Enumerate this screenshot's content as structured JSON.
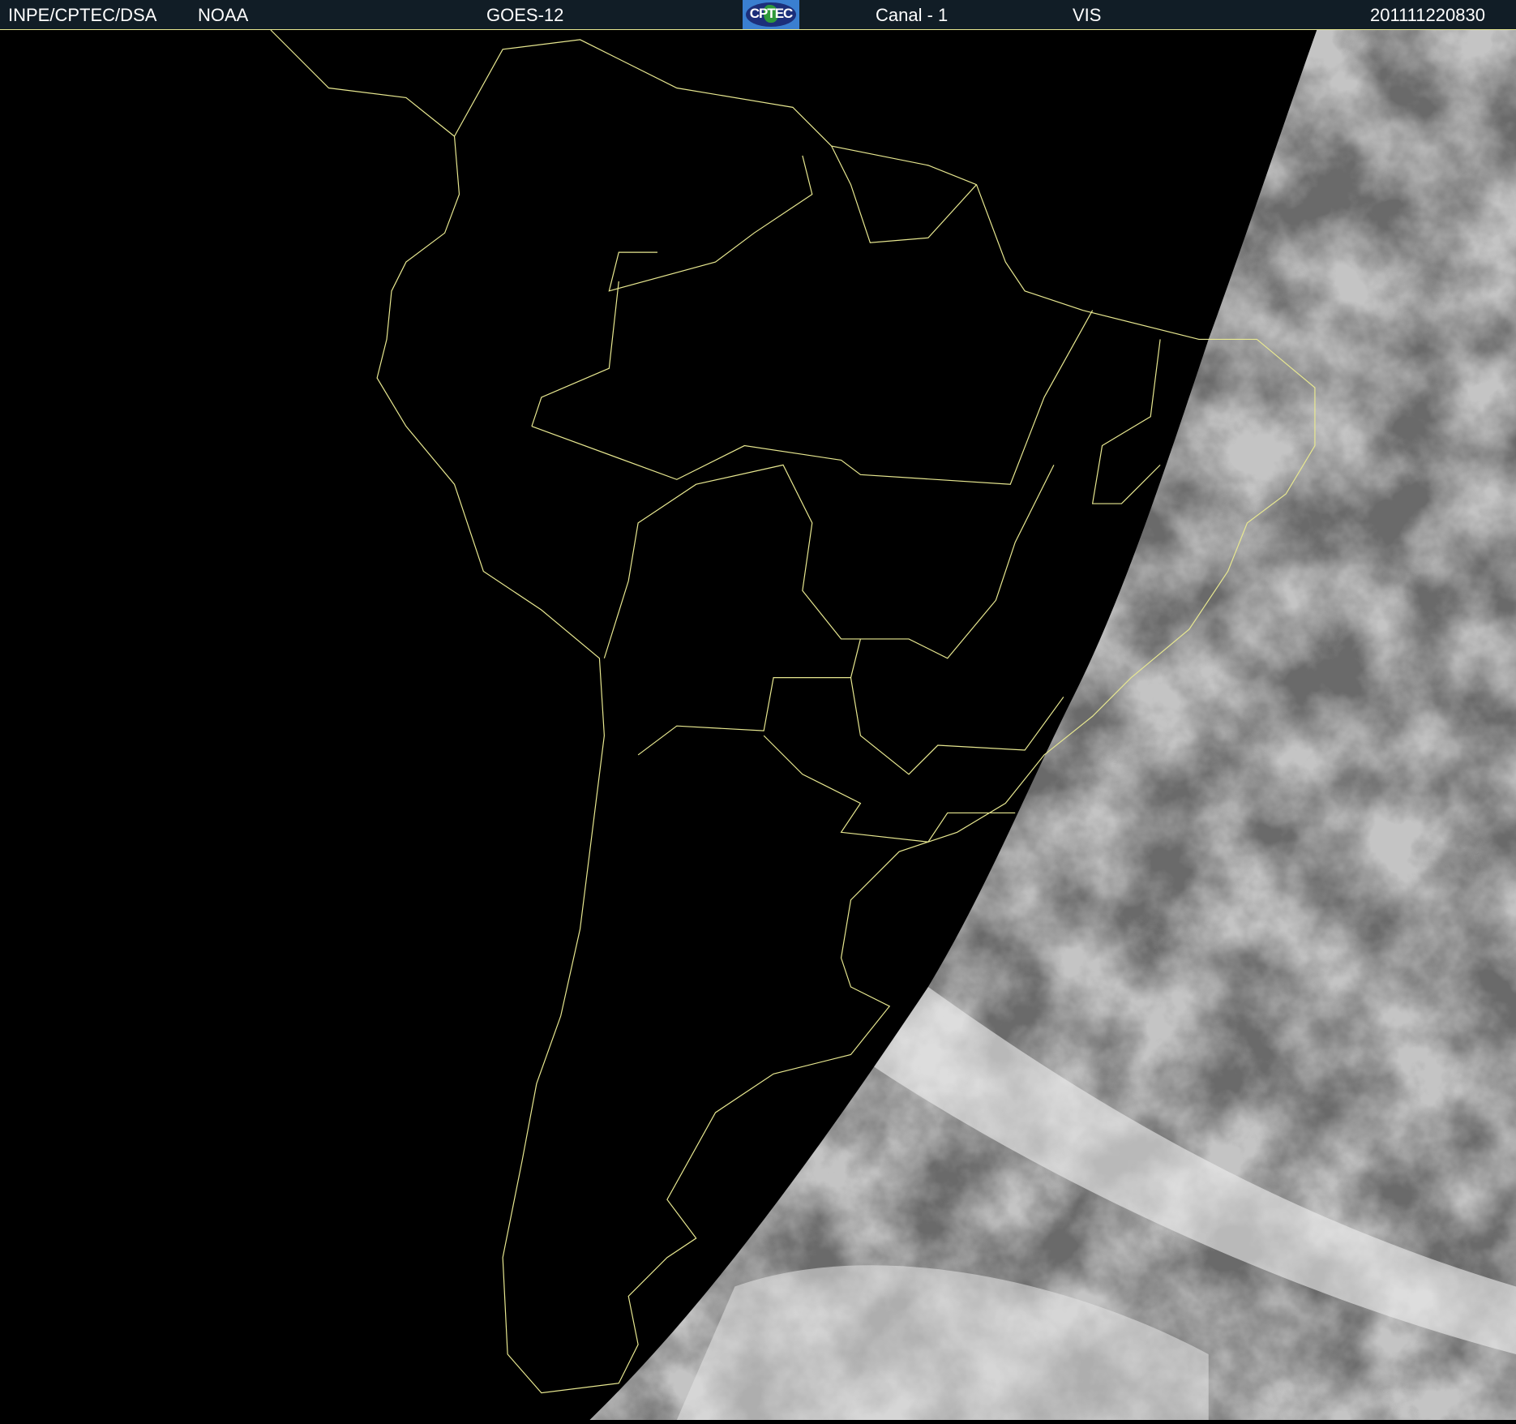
{
  "header": {
    "agency": "INPE/CPTEC/DSA",
    "source": "NOAA",
    "satellite": "GOES-12",
    "logo_text": "CPTEC",
    "channel": "Canal - 1",
    "band": "VIS",
    "timestamp": "201111220830"
  },
  "colors": {
    "header_bg": "#111d26",
    "outline": "#e8e890",
    "night": "#000000"
  }
}
